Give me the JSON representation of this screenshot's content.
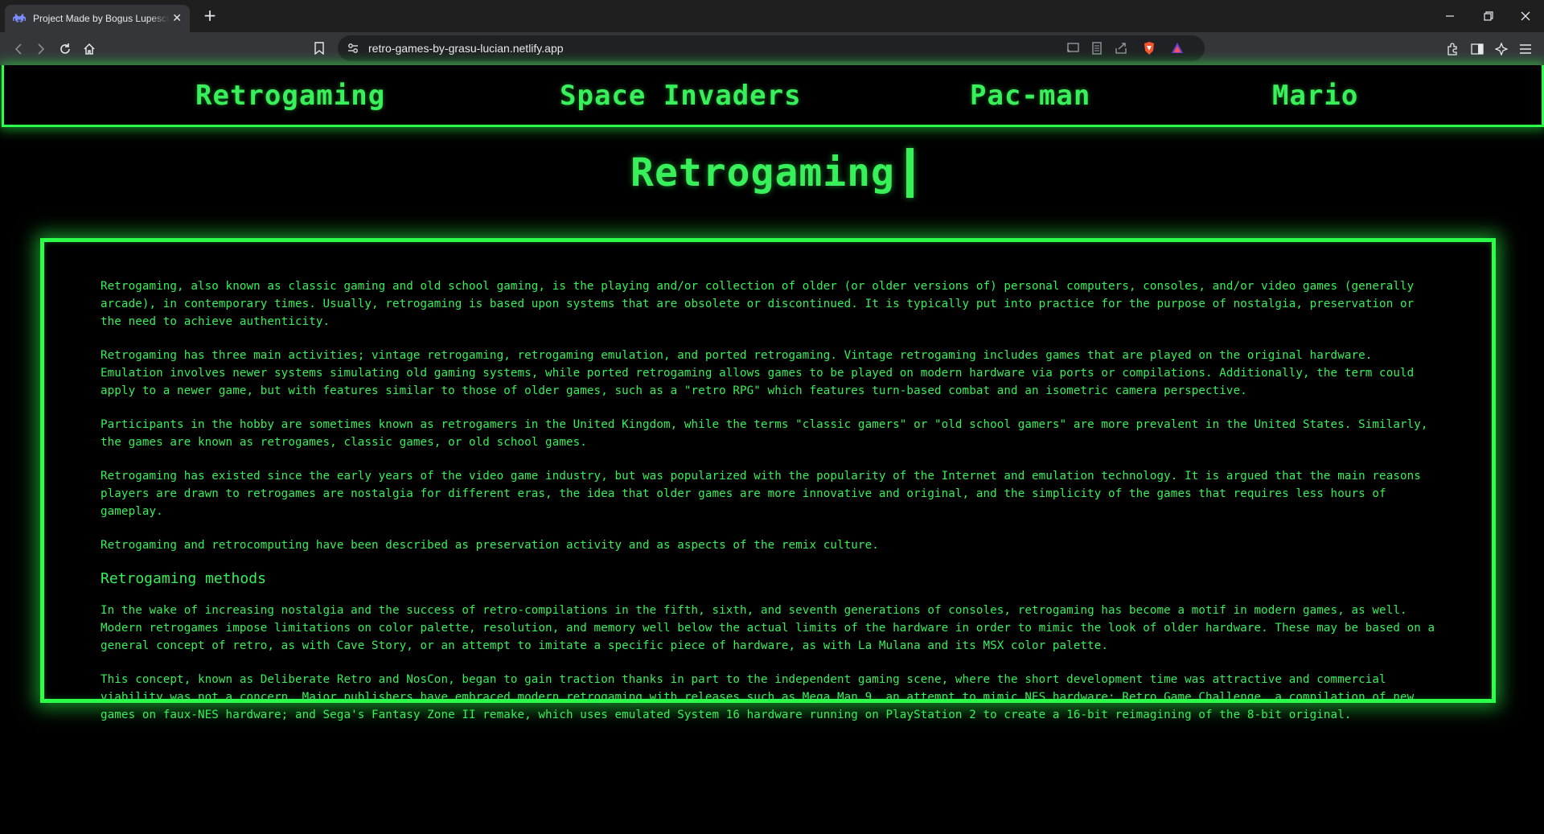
{
  "browser": {
    "tab_title": "Project Made by Bogus Lupescu",
    "url": "retro-games-by-grasu-lucian.netlify.app"
  },
  "nav": {
    "items": [
      "Retrogaming",
      "Space Invaders",
      "Pac-man",
      "Mario"
    ]
  },
  "page": {
    "title": "Retrogaming",
    "paragraphs": [
      "Retrogaming, also known as classic gaming and old school gaming, is the playing and/or collection of older (or older versions of) personal computers, consoles, and/or video games (generally arcade), in contemporary times. Usually, retrogaming is based upon systems that are obsolete or discontinued. It is typically put into practice for the purpose of nostalgia, preservation or the need to achieve authenticity.",
      "Retrogaming has three main activities; vintage retrogaming, retrogaming emulation, and ported retrogaming. Vintage retrogaming includes games that are played on the original hardware. Emulation involves newer systems simulating old gaming systems, while ported retrogaming allows games to be played on modern hardware via ports or compilations. Additionally, the term could apply to a newer game, but with features similar to those of older games, such as a \"retro RPG\" which features turn-based combat and an isometric camera perspective.",
      "Participants in the hobby are sometimes known as retrogamers in the United Kingdom, while the terms \"classic gamers\" or \"old school gamers\" are more prevalent in the United States. Similarly, the games are known as retrogames, classic games, or old school games.",
      "Retrogaming has existed since the early years of the video game industry, but was popularized with the popularity of the Internet and emulation technology. It is argued that the main reasons players are drawn to retrogames are nostalgia for different eras, the idea that older games are more innovative and original, and the simplicity of the games that requires less hours of gameplay.",
      "Retrogaming and retrocomputing have been described as preservation activity and as aspects of the remix culture."
    ],
    "section_heading": "Retrogaming methods",
    "section_paragraphs": [
      "In the wake of increasing nostalgia and the success of retro-compilations in the fifth, sixth, and seventh generations of consoles, retrogaming has become a motif in modern games, as well. Modern retrogames impose limitations on color palette, resolution, and memory well below the actual limits of the hardware in order to mimic the look of older hardware. These may be based on a general concept of retro, as with Cave Story, or an attempt to imitate a specific piece of hardware, as with La Mulana and its MSX color palette.",
      "This concept, known as Deliberate Retro and NosCon, began to gain traction thanks in part to the independent gaming scene, where the short development time was attractive and commercial viability was not a concern. Major publishers have embraced modern retrogaming with releases such as Mega Man 9, an attempt to mimic NES hardware; Retro Game Challenge, a compilation of new games on faux-NES hardware; and Sega's Fantasy Zone II remake, which uses emulated System 16 hardware running on PlayStation 2 to create a 16-bit reimagining of the 8-bit original."
    ]
  },
  "colors": {
    "accent": "#2bff4a",
    "text": "#38f05a",
    "background": "#000000",
    "chrome_dark": "#1f1f1f",
    "chrome": "#35363a"
  },
  "icons": {
    "favicon": "space-invader-icon",
    "tab_close": "close-icon",
    "new_tab": "plus-icon",
    "back": "back-arrow-icon",
    "forward": "forward-arrow-icon",
    "reload": "reload-icon",
    "home": "home-icon",
    "bookmark": "bookmark-icon",
    "site_info": "site-settings-icon",
    "cast": "cast-icon",
    "reader": "reader-mode-icon",
    "share": "share-icon",
    "brave_shield": "brave-shield-icon",
    "brave_rewards": "brave-rewards-icon",
    "extensions": "extensions-icon",
    "sidebar": "sidebar-icon",
    "leo": "leo-ai-icon",
    "menu": "menu-icon",
    "minimize": "minimize-icon",
    "restore": "restore-icon",
    "close_window": "close-window-icon"
  }
}
